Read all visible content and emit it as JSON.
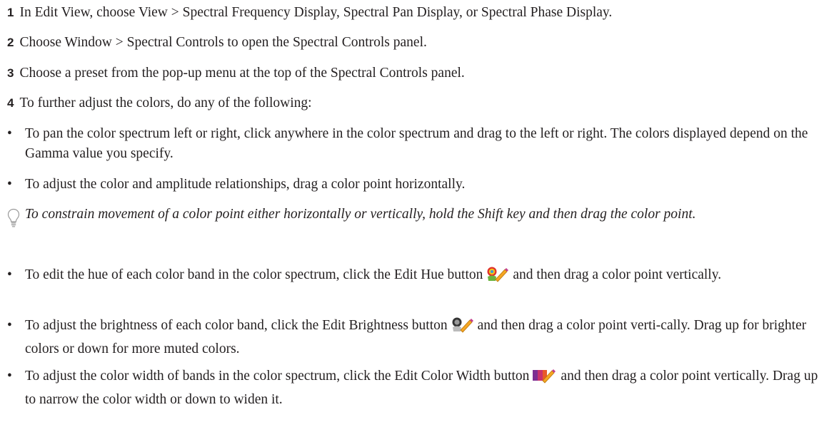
{
  "steps": [
    {
      "num": "1",
      "text": "In Edit View, choose View > Spectral Frequency Display, Spectral Pan Display, or Spectral Phase Display."
    },
    {
      "num": "2",
      "text": "Choose Window > Spectral Controls to open the Spectral Controls panel."
    },
    {
      "num": "3",
      "text": "Choose a preset from the pop-up menu at the top of the Spectral Controls panel."
    },
    {
      "num": "4",
      "text": "To further adjust the colors, do any of the following:"
    }
  ],
  "bullet_char": "•",
  "bullets_a": [
    {
      "text": "To pan the color spectrum left or right, click anywhere in the color spectrum and drag to the left or right. The colors displayed depend on the Gamma value you specify."
    },
    {
      "text": "To adjust the color and amplitude relationships, drag a color point horizontally."
    }
  ],
  "tip": {
    "icon": "lightbulb-icon",
    "text": "To constrain movement of a color point either horizontally or vertically, hold the Shift key and then drag the color point."
  },
  "bullets_b": [
    {
      "before": "To edit the hue of each color band in the color spectrum, click the Edit Hue button",
      "icon": "edit-hue-icon",
      "after": "and then drag a color point vertically."
    },
    {
      "before": "To adjust the brightness of each color band, click the Edit Brightness button",
      "icon": "edit-brightness-icon",
      "after": "and then drag a color point verti-cally. Drag up for brighter colors or down for more muted colors."
    },
    {
      "before": "To adjust the color width of bands in the color spectrum, click the Edit Color Width button",
      "icon": "edit-color-width-icon",
      "after": "and then drag a color point vertically. Drag up to narrow the color width or down to widen it."
    }
  ]
}
